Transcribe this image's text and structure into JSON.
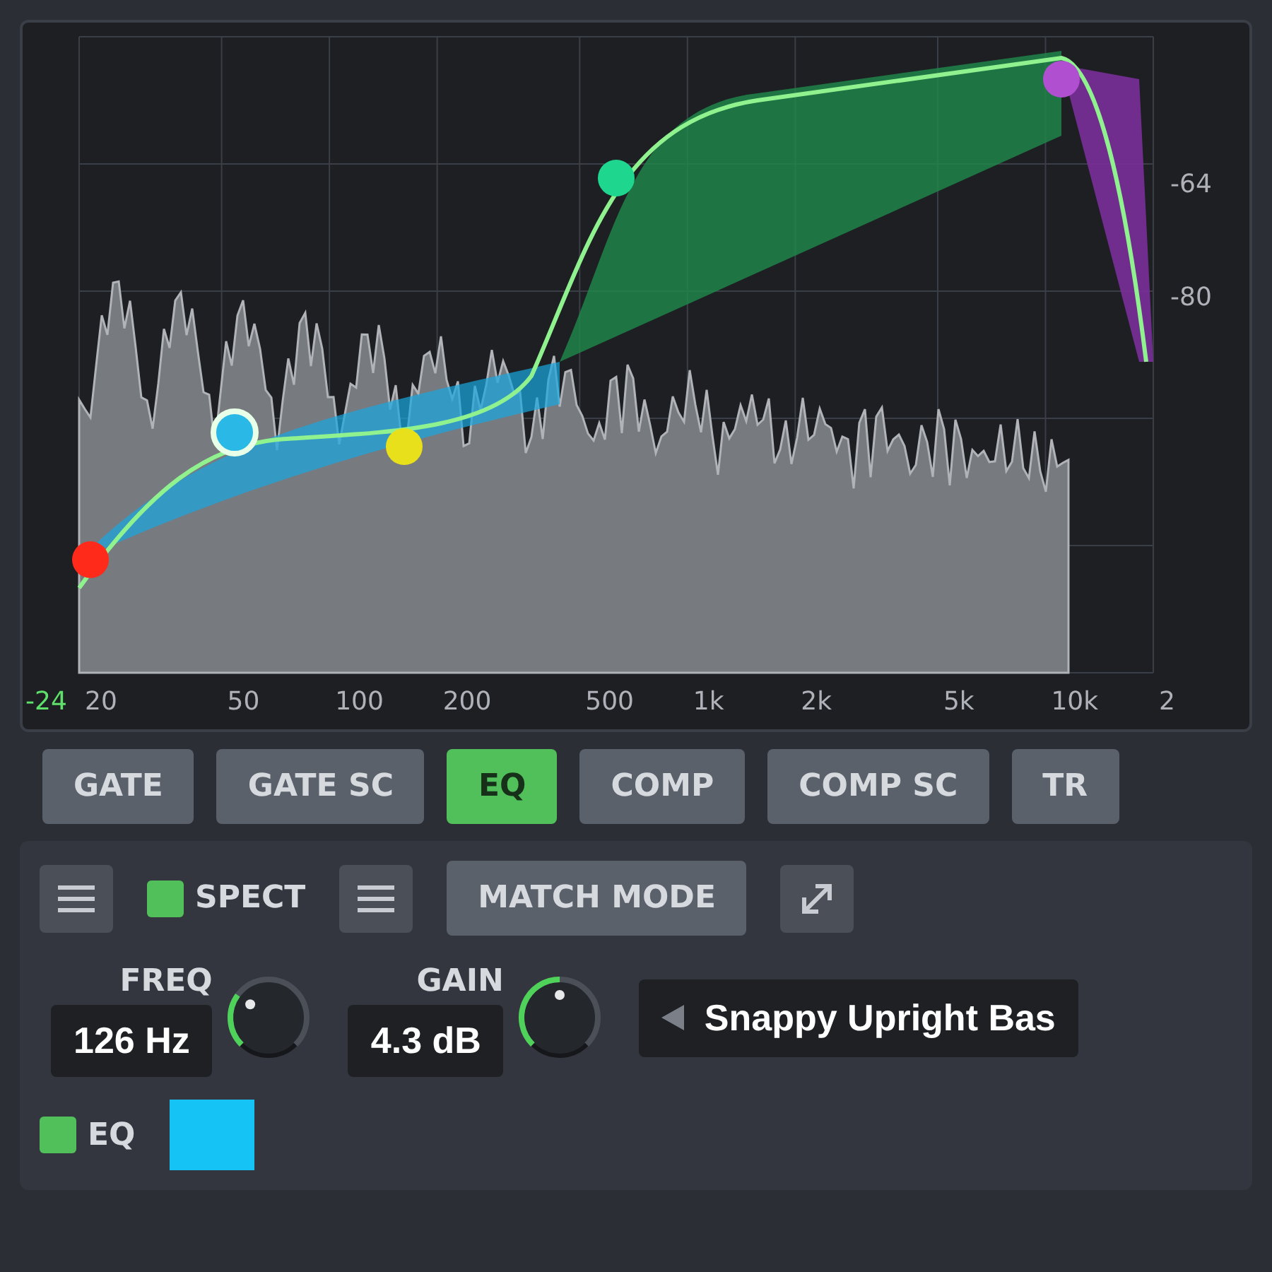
{
  "graph": {
    "db_labels": [
      "-64",
      "-80"
    ],
    "reference_level": "-24",
    "freq_labels": [
      "20",
      "50",
      "100",
      "200",
      "500",
      "1k",
      "2k",
      "5k",
      "10k",
      "2"
    ],
    "bands": [
      {
        "color": "#ff2a1a",
        "selected": false
      },
      {
        "color": "#2ab8e6",
        "selected": true
      },
      {
        "color": "#e8e01a",
        "selected": false
      },
      {
        "color": "#1ed68e",
        "selected": false
      },
      {
        "color": "#b050d0",
        "selected": false
      }
    ]
  },
  "tabs": [
    {
      "label": "GATE",
      "selected": false
    },
    {
      "label": "GATE SC",
      "selected": false
    },
    {
      "label": "EQ",
      "selected": true
    },
    {
      "label": "COMP",
      "selected": false
    },
    {
      "label": "COMP SC",
      "selected": false
    },
    {
      "label": "TR",
      "selected": false
    }
  ],
  "controls": {
    "spect": {
      "label": "SPECT",
      "checked": true
    },
    "match_mode": "MATCH MODE",
    "freq": {
      "label": "FREQ",
      "value": "126 Hz",
      "level": 0.3
    },
    "gain": {
      "label": "GAIN",
      "value": "4.3 dB",
      "level": 0.5
    },
    "preset": {
      "name": "Snappy Upright Bas"
    }
  },
  "bottom": {
    "eq": {
      "label": "EQ",
      "checked": true
    }
  }
}
